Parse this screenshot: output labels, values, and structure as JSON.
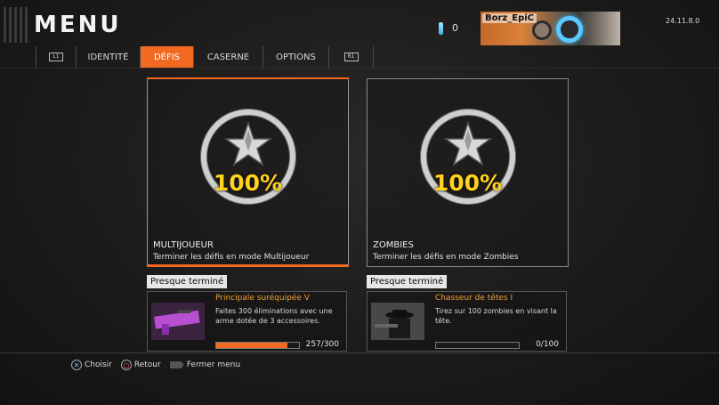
{
  "header": {
    "title": "MENU",
    "currency_value": "0",
    "gamertag": "Borz_EpiC",
    "version": "24.11.8.0"
  },
  "nav": {
    "left_button": "L1",
    "right_button": "R1",
    "tabs": [
      {
        "label": "IDENTITÉ",
        "active": false
      },
      {
        "label": "DÉFIS",
        "active": true
      },
      {
        "label": "CASERNE",
        "active": false
      },
      {
        "label": "OPTIONS",
        "active": false
      }
    ]
  },
  "cards": [
    {
      "percent": "100%",
      "title": "MULTIJOUEUR",
      "description": "Terminer les défis en mode Multijoueur",
      "selected": true
    },
    {
      "percent": "100%",
      "title": "ZOMBIES",
      "description": "Terminer les défis en mode Zombies",
      "selected": false
    }
  ],
  "almost_done": [
    {
      "label": "Presque terminé",
      "title": "Principale suréquipée  V",
      "description": "Faites 300 éliminations avec une arme dotée de 3 accessoires.",
      "progress_text": "257/300",
      "progress": 0.857
    },
    {
      "label": "Presque terminé",
      "title": "Chasseur de têtes I",
      "description": "Tirez sur 100 zombies en visant la tête.",
      "progress_text": "0/100",
      "progress": 0.0
    }
  ],
  "footer": {
    "choose": "Choisir",
    "back": "Retour",
    "close": "Fermer menu"
  },
  "colors": {
    "accent": "#f26a21",
    "percent": "#ffd21e",
    "challenge_title": "#f4a032"
  }
}
